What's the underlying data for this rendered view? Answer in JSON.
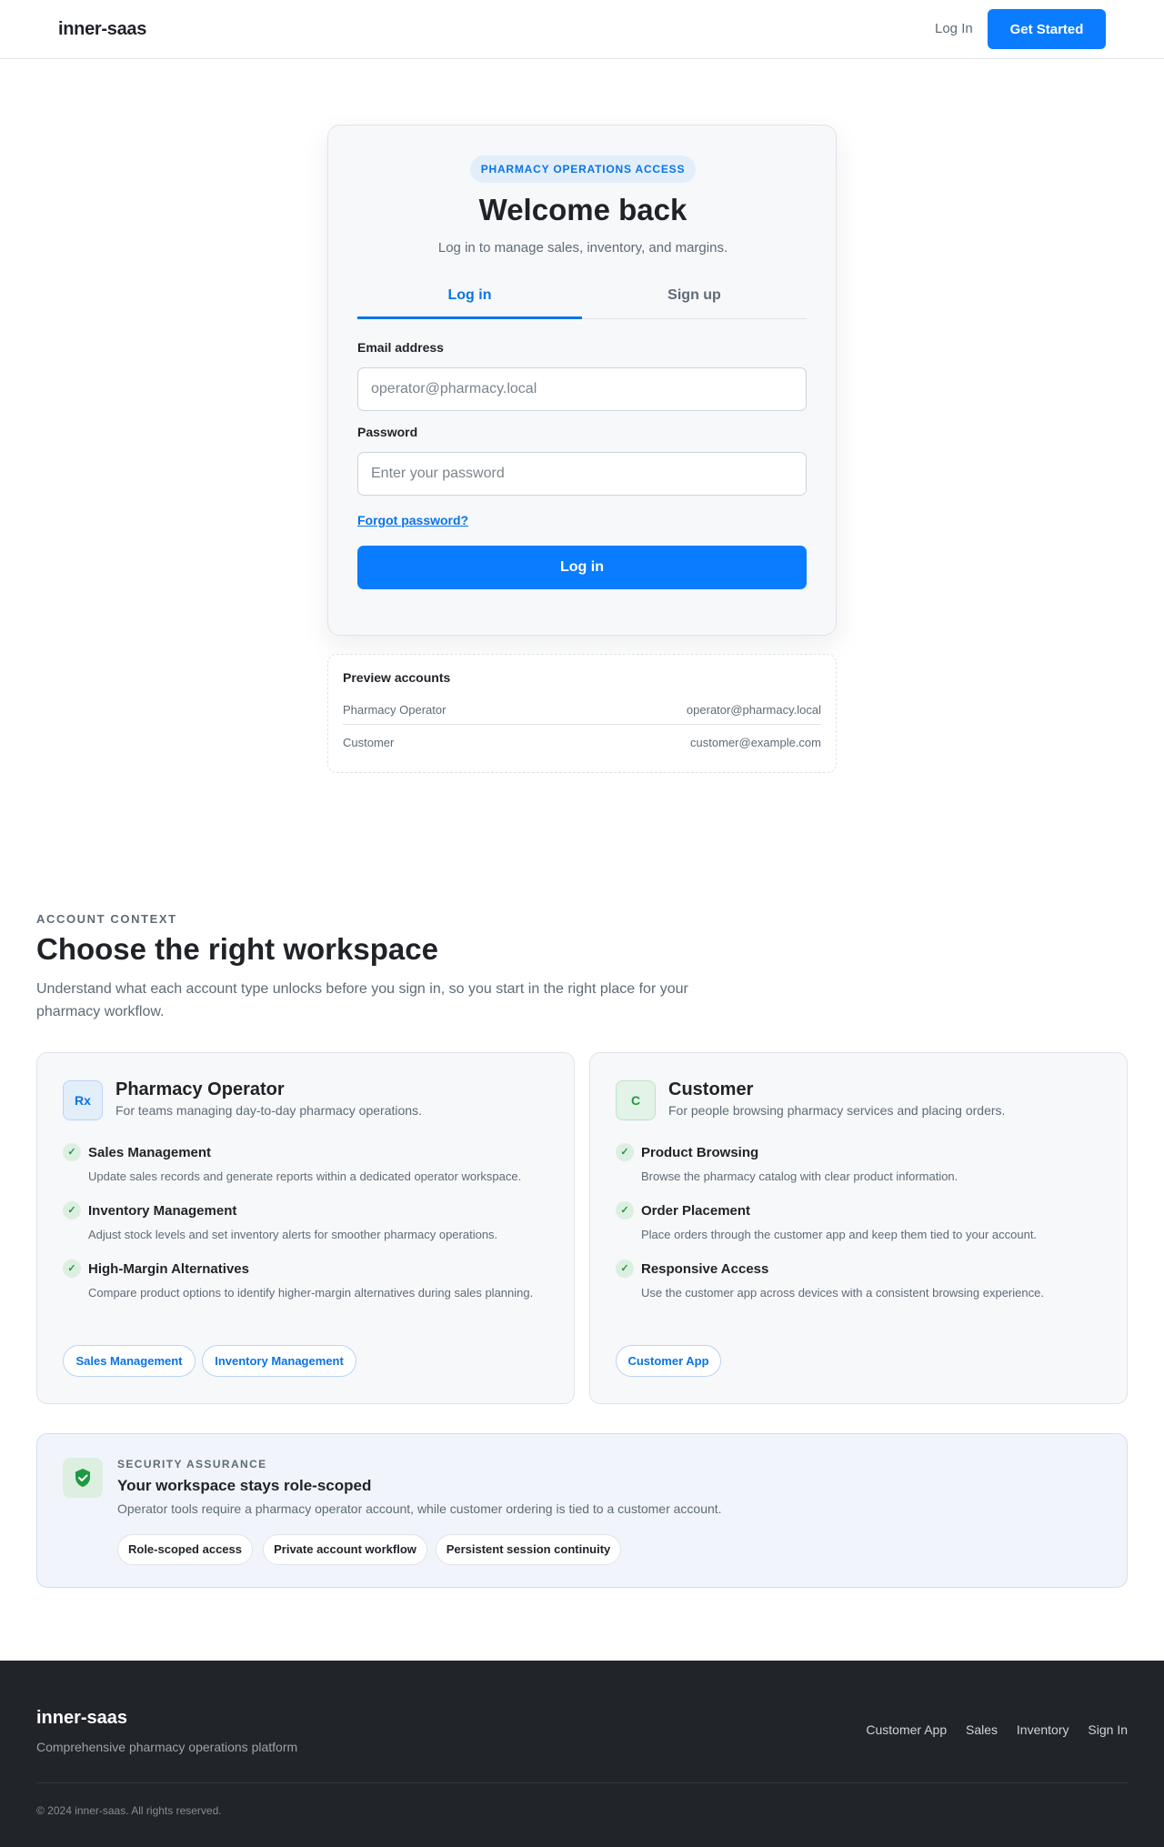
{
  "header": {
    "brand": "inner-saas",
    "login_link": "Log In",
    "cta_button": "Get Started"
  },
  "auth": {
    "eyebrow": "PHARMACY OPERATIONS ACCESS",
    "title": "Welcome back",
    "subtitle": "Log in to manage sales, inventory, and margins.",
    "tabs": [
      {
        "label": "Log in",
        "active": true
      },
      {
        "label": "Sign up",
        "active": false
      }
    ],
    "email": {
      "label": "Email address",
      "placeholder": "operator@pharmacy.local",
      "value": ""
    },
    "password": {
      "label": "Password",
      "placeholder": "Enter your password",
      "value": ""
    },
    "forgot_link": "Forgot password?",
    "submit_button": "Log in"
  },
  "preview_accounts": {
    "title": "Preview accounts",
    "rows": [
      {
        "role": "Pharmacy Operator",
        "email": "operator@pharmacy.local"
      },
      {
        "role": "Customer",
        "email": "customer@example.com"
      }
    ]
  },
  "account_context": {
    "eyebrow": "ACCOUNT CONTEXT",
    "title": "Choose the right workspace",
    "subtitle": "Understand what each account type unlocks before you sign in, so you start in the right place for your pharmacy workflow.",
    "workspaces": [
      {
        "badge": "Rx",
        "name": "Pharmacy Operator",
        "description": "For teams managing day-to-day pharmacy operations.",
        "features": [
          {
            "title": "Sales Management",
            "description": "Update sales records and generate reports within a dedicated operator workspace."
          },
          {
            "title": "Inventory Management",
            "description": "Adjust stock levels and set inventory alerts for smoother pharmacy operations."
          },
          {
            "title": "High-Margin Alternatives",
            "description": "Compare product options to identify higher-margin alternatives during sales planning."
          }
        ],
        "chips": [
          "Sales Management",
          "Inventory Management"
        ]
      },
      {
        "badge": "C",
        "name": "Customer",
        "description": "For people browsing pharmacy services and placing orders.",
        "features": [
          {
            "title": "Product Browsing",
            "description": "Browse the pharmacy catalog with clear product information."
          },
          {
            "title": "Order Placement",
            "description": "Place orders through the customer app and keep them tied to your account."
          },
          {
            "title": "Responsive Access",
            "description": "Use the customer app across devices with a consistent browsing experience."
          }
        ],
        "chips": [
          "Customer App"
        ]
      }
    ]
  },
  "security": {
    "eyebrow": "SECURITY ASSURANCE",
    "title": "Your workspace stays role-scoped",
    "description": "Operator tools require a pharmacy operator account, while customer ordering is tied to a customer account.",
    "chips": [
      "Role-scoped access",
      "Private account workflow",
      "Persistent session continuity"
    ],
    "icon": "shield-check-icon"
  },
  "footer": {
    "brand": "inner-saas",
    "tagline": "Comprehensive pharmacy operations platform",
    "links": [
      "Customer App",
      "Sales",
      "Inventory",
      "Sign In"
    ],
    "copyright": "© 2024 inner-saas. All rights reserved."
  },
  "colors": {
    "accent": "#0a7cff",
    "success": "#1f9a44",
    "footer_bg": "#212429"
  }
}
